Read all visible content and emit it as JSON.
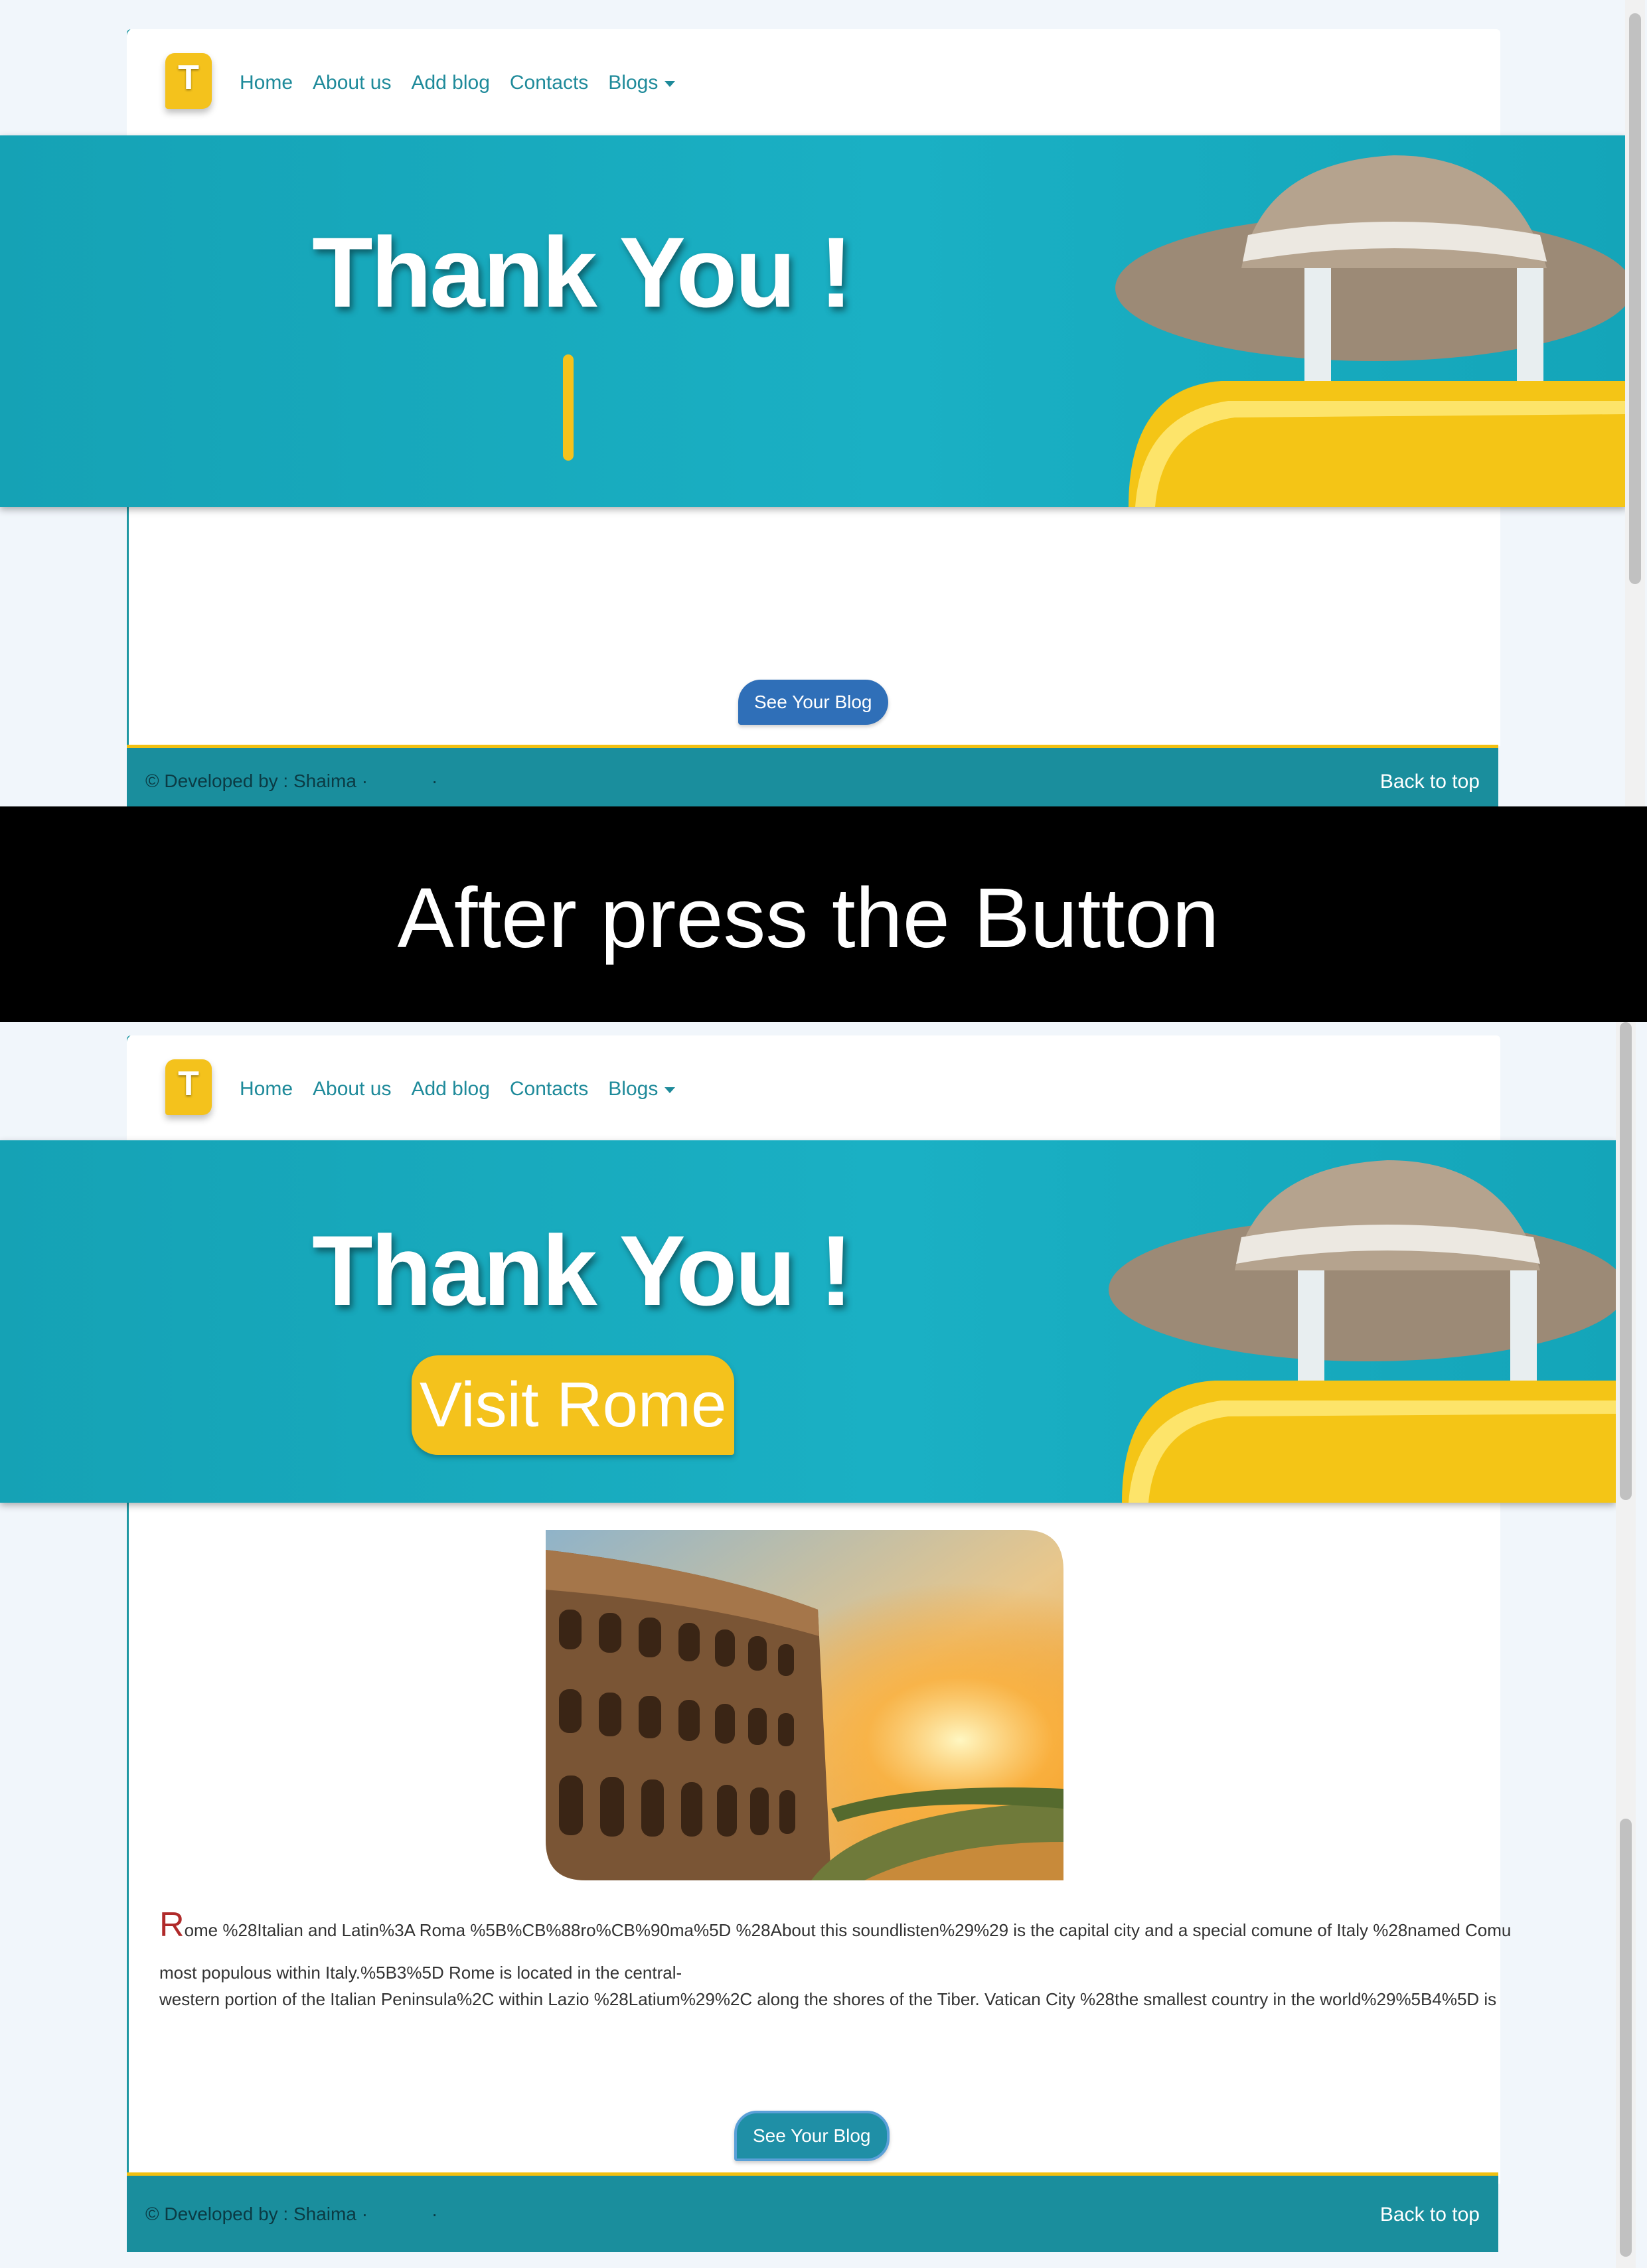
{
  "nav": {
    "logo_letter": "T",
    "items": [
      "Home",
      "About us",
      "Add blog",
      "Contacts",
      "Blogs"
    ]
  },
  "banner": {
    "title": "Thank You !"
  },
  "divider": {
    "caption": "After press the Button"
  },
  "after": {
    "badge": "Visit Rome",
    "paragraph_initial": "R",
    "paragraph_line1": "ome %28Italian and Latin%3A Roma %5B%CB%88ro%CB%90ma%5D %28About this soundlisten%29%29 is the capital city and a special comune of Italy %28named Comu",
    "paragraph_line2": "most populous within Italy.%5B3%5D Rome is located in the central-",
    "paragraph_line3": "western portion of the Italian Peninsula%2C within Lazio %28Latium%29%2C along the shores of the Tiber. Vatican City %28the smallest country in the world%29%5B4%5D is"
  },
  "button": {
    "label": "See Your Blog"
  },
  "footer": {
    "credit": "© Developed by : Shaima ·",
    "dot": "·",
    "back_to_top": "Back to top"
  },
  "colors": {
    "teal": "#1ab0c4",
    "accent_yellow": "#f4c21c",
    "button_blue": "#2f6fb8",
    "footer_teal": "#1a8e9d"
  }
}
